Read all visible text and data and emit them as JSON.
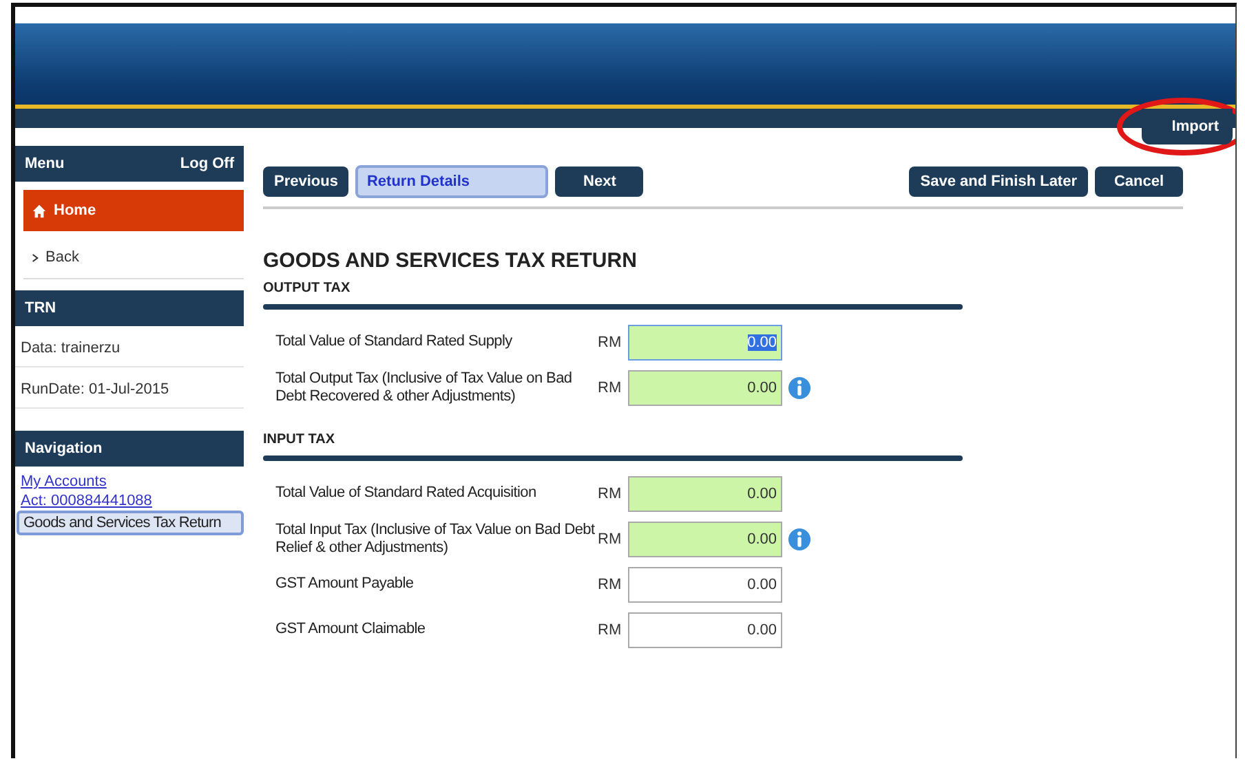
{
  "header": {
    "import_tab": {
      "label": "Import",
      "highlighted": true
    }
  },
  "sidebar": {
    "menu": {
      "title": "Menu",
      "logoff": "Log Off"
    },
    "items": [
      {
        "kind": "home",
        "label": "Home",
        "selected": true
      },
      {
        "kind": "back",
        "label": "Back",
        "selected": false
      }
    ],
    "trn": {
      "title": "TRN",
      "lines": [
        "Data: trainerzu",
        "RunDate: 01-Jul-2015"
      ]
    },
    "navigation": {
      "title": "Navigation",
      "links": [
        {
          "label": "My Accounts",
          "selected": false
        },
        {
          "label": "Act: 000884441088",
          "selected": false
        },
        {
          "label": "Goods and Services Tax Return",
          "selected": true
        }
      ]
    }
  },
  "toolbar": {
    "previous": "Previous",
    "step": "Return Details",
    "next": "Next",
    "save": "Save and Finish Later",
    "cancel": "Cancel"
  },
  "form": {
    "title": "GOODS AND SERVICES TAX RETURN",
    "sections": [
      {
        "title": "OUTPUT TAX",
        "fields": [
          {
            "label": "Total Value of Standard Rated Supply",
            "currency": "RM",
            "value": "0.00",
            "kind": "required",
            "info": false,
            "focused": true
          },
          {
            "label": "Total Output Tax (Inclusive of Tax Value on Bad Debt Recovered & other Adjustments)",
            "currency": "RM",
            "value": "0.00",
            "kind": "required",
            "info": true,
            "focused": false
          }
        ]
      },
      {
        "title": "INPUT TAX",
        "fields": [
          {
            "label": "Total Value of Standard Rated Acquisition",
            "currency": "RM",
            "value": "0.00",
            "kind": "required",
            "info": false,
            "focused": false
          },
          {
            "label": "Total Input Tax (Inclusive of Tax Value on Bad Debt Relief & other Adjustments)",
            "currency": "RM",
            "value": "0.00",
            "kind": "required",
            "info": true,
            "focused": false
          },
          {
            "label": "GST Amount Payable",
            "currency": "RM",
            "value": "0.00",
            "kind": "plain",
            "info": false,
            "focused": false
          },
          {
            "label": "GST Amount Claimable",
            "currency": "RM",
            "value": "0.00",
            "kind": "plain",
            "info": false,
            "focused": false
          }
        ]
      }
    ]
  }
}
